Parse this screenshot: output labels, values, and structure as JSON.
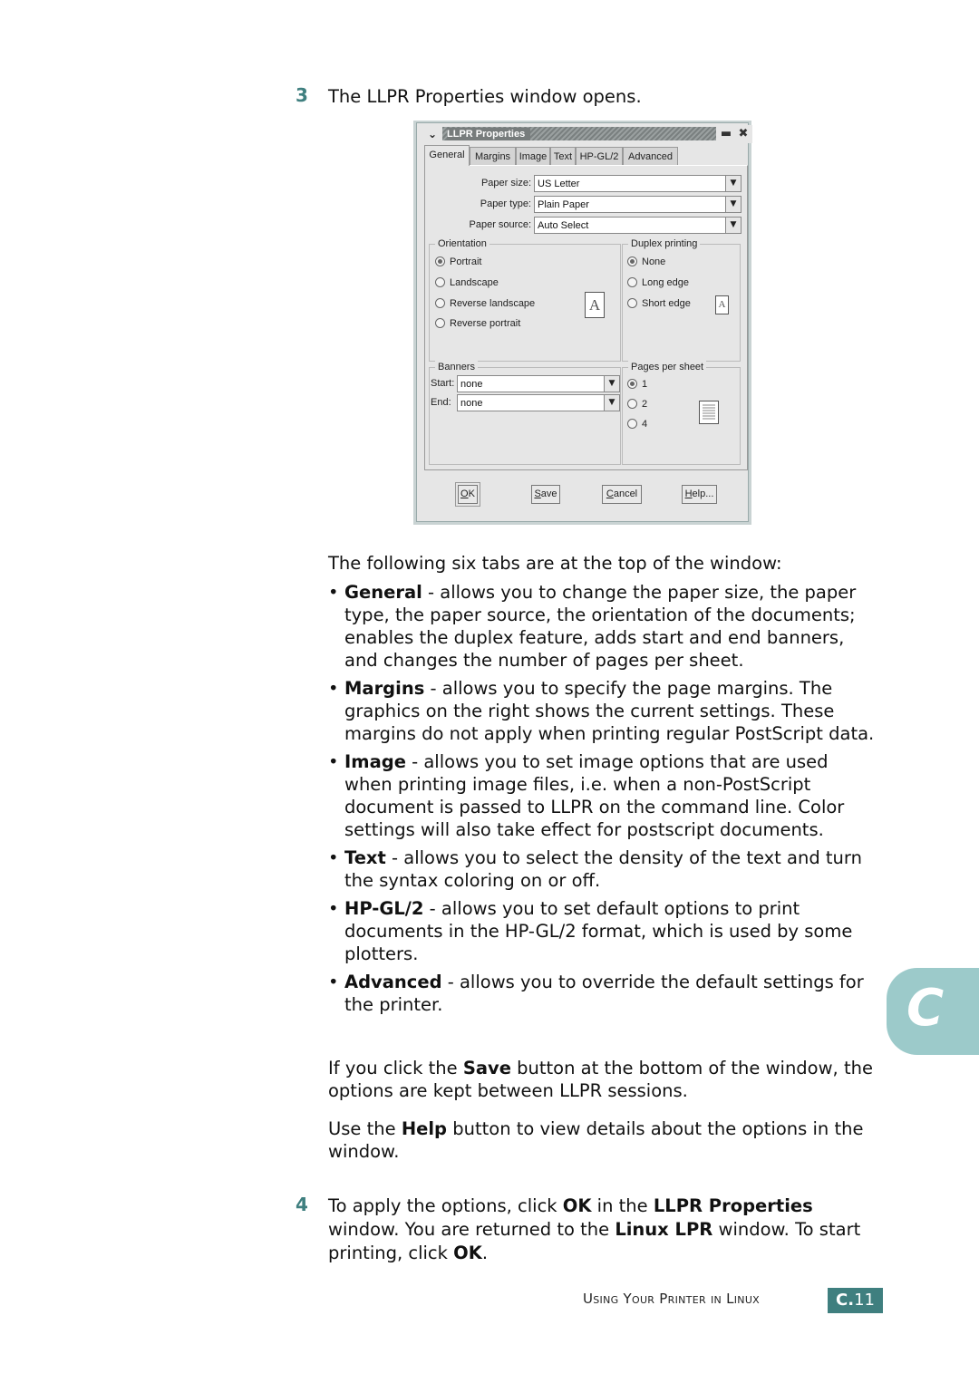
{
  "step3": {
    "number": "3",
    "text": "The LLPR Properties window opens."
  },
  "window": {
    "title": "LLPR Properties",
    "menu_icon": "chevron-down-icon",
    "minimize_icon": "minimize-icon",
    "close_icon": "close-icon",
    "tabs": [
      {
        "label": "General",
        "active": true
      },
      {
        "label": "Margins",
        "active": false
      },
      {
        "label": "Image",
        "active": false
      },
      {
        "label": "Text",
        "active": false
      },
      {
        "label": "HP-GL/2",
        "active": false
      },
      {
        "label": "Advanced",
        "active": false
      }
    ],
    "paper_size": {
      "label": "Paper size:",
      "value": "US Letter"
    },
    "paper_type": {
      "label": "Paper type:",
      "value": "Plain Paper"
    },
    "paper_source": {
      "label": "Paper source:",
      "value": "Auto Select"
    },
    "orientation": {
      "title": "Orientation",
      "options": [
        "Portrait",
        "Landscape",
        "Reverse landscape",
        "Reverse portrait"
      ],
      "selected": "Portrait",
      "preview_glyph": "A"
    },
    "duplex": {
      "title": "Duplex printing",
      "options": [
        "None",
        "Long edge",
        "Short edge"
      ],
      "selected": "None",
      "preview_glyph": "A"
    },
    "banners": {
      "title": "Banners",
      "start_label": "Start:",
      "start_value": "none",
      "end_label": "End:",
      "end_value": "none"
    },
    "pages_per_sheet": {
      "title": "Pages per sheet",
      "options": [
        "1",
        "2",
        "4"
      ],
      "selected": "1"
    },
    "buttons": {
      "ok": {
        "mnemonic": "O",
        "rest": "K"
      },
      "save": {
        "mnemonic": "S",
        "rest": "ave"
      },
      "cancel": {
        "mnemonic": "C",
        "rest": "ancel"
      },
      "help": {
        "mnemonic": "H",
        "rest": "elp..."
      }
    }
  },
  "intro": "The following six tabs are at the top of the window:",
  "bullets": [
    {
      "term": "General",
      "text": " - allows you to change the paper size, the paper type, the paper source, the orientation of the documents; enables the duplex feature, adds start and end banners, and changes the number of pages per sheet."
    },
    {
      "term": "Margins",
      "text": " - allows you to specify the page margins. The graphics on the right shows the current settings. These margins do not apply when printing regular PostScript data."
    },
    {
      "term": "Image",
      "text": " - allows you to set image options that are used when printing image files, i.e. when a non-PostScript document is passed to LLPR on the command line. Color settings will also take effect for postscript documents."
    },
    {
      "term": "Text",
      "text": " - allows you to select the density of the text and turn the syntax coloring on or off."
    },
    {
      "term": "HP-GL/2",
      "text": " - allows you to set default options to print documents in the HP-GL/2 format, which is used by some plotters."
    },
    {
      "term": "Advanced",
      "text": " - allows you to override the default settings for the printer."
    }
  ],
  "save_para": {
    "pre": "If you click the ",
    "bold": "Save",
    "post": " button at the bottom of the window, the options are kept between LLPR sessions."
  },
  "help_para": {
    "pre": "Use the ",
    "bold": "Help",
    "post": " button to view details about the options in the window."
  },
  "step4": {
    "number": "4",
    "parts": [
      {
        "t": "To apply the options, click ",
        "b": false
      },
      {
        "t": "OK",
        "b": true
      },
      {
        "t": " in the ",
        "b": false
      },
      {
        "t": "LLPR Properties",
        "b": true
      },
      {
        "t": " window. You are returned to the ",
        "b": false
      },
      {
        "t": "Linux LPR",
        "b": true
      },
      {
        "t": " window. To start printing, click ",
        "b": false
      },
      {
        "t": "OK",
        "b": true
      },
      {
        "t": ".",
        "b": false
      }
    ]
  },
  "footer": {
    "section_title": "Using Your Printer in Linux",
    "page_prefix": "C.",
    "page_number": "11"
  },
  "chapter_tab": {
    "letter": "C"
  },
  "colors": {
    "accent": "#3f7f7f",
    "chapter_tab": "#9ccaca"
  }
}
